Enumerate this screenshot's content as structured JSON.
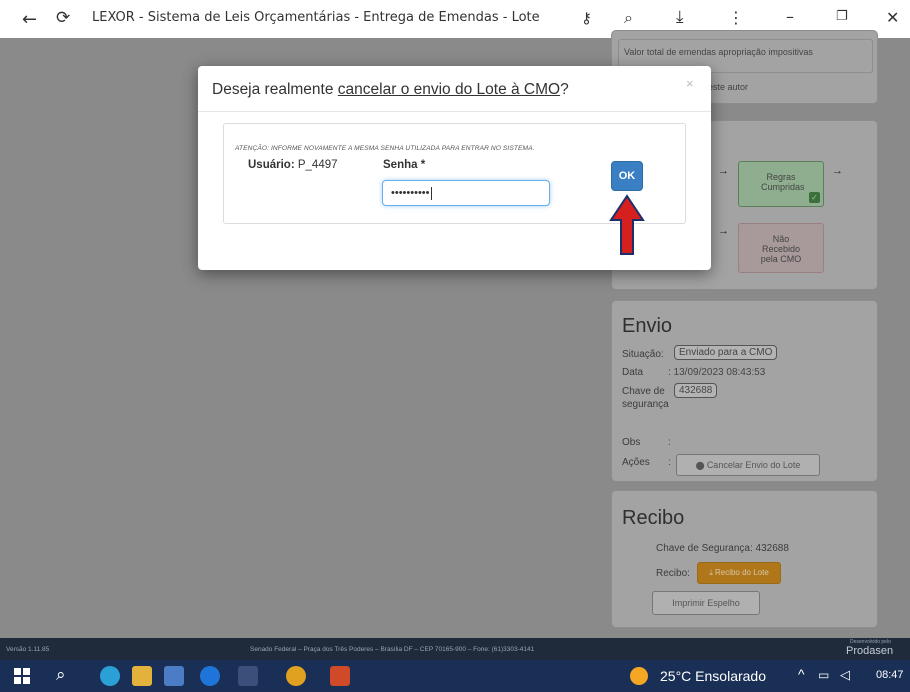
{
  "browser": {
    "title": "LEXOR - Sistema de Leis Orçamentárias - Entrega de Emendas - Lote"
  },
  "right_panel_top": {
    "text1": "Valor total de emendas apropriação impositivas",
    "text2": "este autor"
  },
  "flow": {
    "regras": "Regras Cumpridas",
    "nao_recebido": "Não Recebido pela CMO"
  },
  "envio": {
    "title": "Envio",
    "situacao_label": "Situação:",
    "situacao_value": "Enviado para a CMO",
    "data_label": "Data",
    "data_value": ": 13/09/2023 08:43:53",
    "chave_label": "Chave de segurança",
    "chave_value": "432688",
    "obs_label": "Obs",
    "obs_value": ":",
    "acoes_label": "Ações",
    "acoes_value": ":",
    "cancel_button": "Cancelar Envio do Lote"
  },
  "recibo": {
    "title": "Recibo",
    "chave": "Chave de Segurança: 432688",
    "recibo_label": "Recibo:",
    "recibo_button": "Recibo do Lote",
    "imprimir_button": "Imprimir Espelho"
  },
  "footer": {
    "version": "Versão 1.11.85",
    "address": "Senado Federal – Praça dos Três Poderes – Brasília DF – CEP 70165-900 – Fone: (61)3303-4141",
    "brand_small": "Desenvolvido pelo",
    "brand": "Prodasen"
  },
  "modal": {
    "title_prefix": "Deseja realmente ",
    "title_link": "cancelar o envio do Lote à CMO",
    "title_suffix": "?",
    "close": "×",
    "attention": "ATENÇÃO: INFORME NOVAMENTE A MESMA SENHA UTILIZADA PARA ENTRAR NO SISTEMA.",
    "user_label": "Usuário:",
    "user_value": "P_4497",
    "password_label": "Senha *",
    "password_value": "••••••••••",
    "ok_button": "OK"
  },
  "taskbar": {
    "weather": "25°C  Ensolarado",
    "time": "08:47"
  },
  "colors": {
    "ok": "#3a7fc4",
    "arrow": "#d61f1f",
    "taskbar": "#1a2f55"
  }
}
